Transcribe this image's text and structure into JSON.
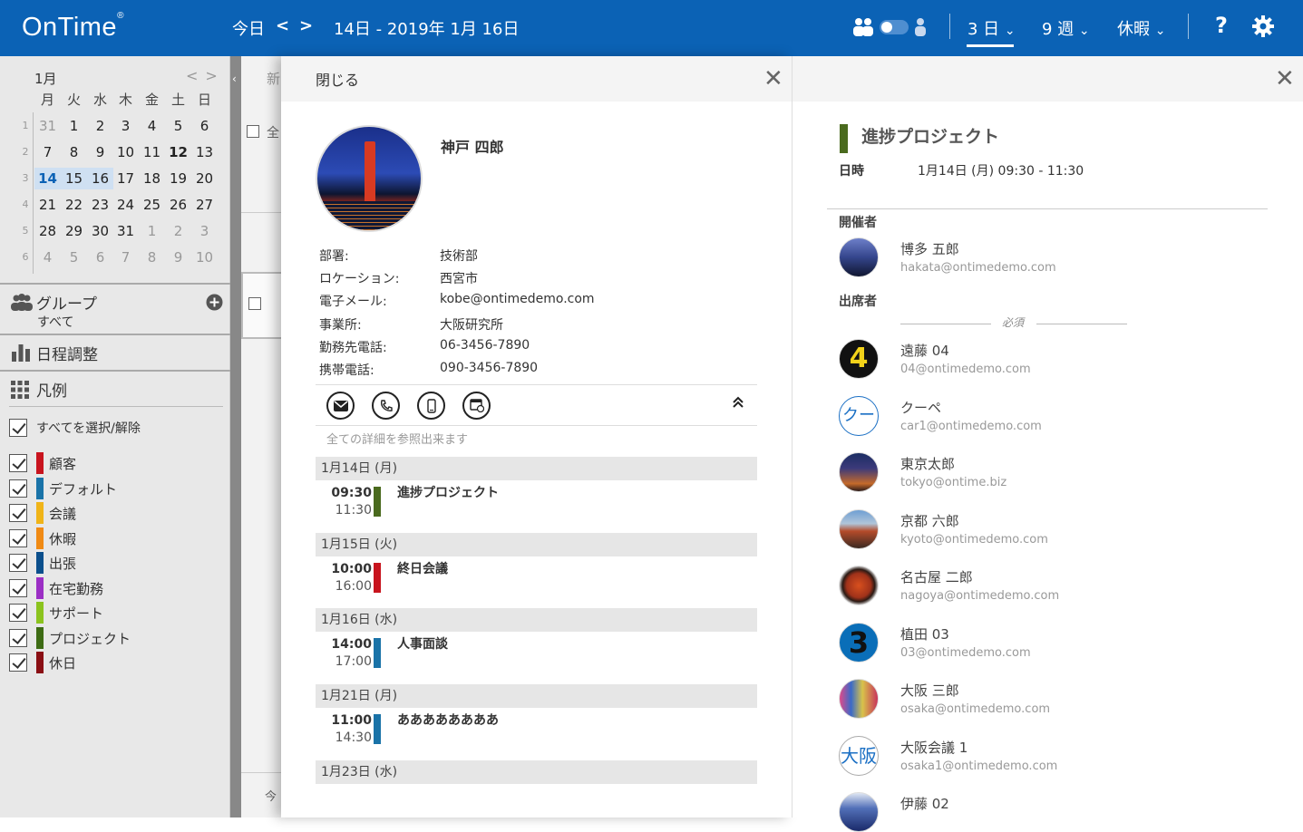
{
  "header": {
    "logo": "OnTime",
    "logo_mark": "®",
    "today": "今日",
    "prev": "<",
    "next": ">",
    "date_range": "14日  -  2019年 1月 16日",
    "view_days": "3 日",
    "view_weeks": "9 週",
    "view_holiday": "休暇",
    "help": "?",
    "chevron": "⌄"
  },
  "mini_calendar": {
    "month": "1月",
    "nav_prev": "<",
    "nav_next": ">",
    "weekdays": [
      "月",
      "火",
      "水",
      "木",
      "金",
      "土",
      "日"
    ],
    "weeks": [
      {
        "no": "1",
        "days": [
          "31",
          "1",
          "2",
          "3",
          "4",
          "5",
          "6"
        ]
      },
      {
        "no": "2",
        "days": [
          "7",
          "8",
          "9",
          "10",
          "11",
          "12",
          "13"
        ]
      },
      {
        "no": "3",
        "days": [
          "14",
          "15",
          "16",
          "17",
          "18",
          "19",
          "20"
        ]
      },
      {
        "no": "4",
        "days": [
          "21",
          "22",
          "23",
          "24",
          "25",
          "26",
          "27"
        ]
      },
      {
        "no": "5",
        "days": [
          "28",
          "29",
          "30",
          "31",
          "1",
          "2",
          "3"
        ]
      },
      {
        "no": "6",
        "days": [
          "4",
          "5",
          "6",
          "7",
          "8",
          "9",
          "10"
        ]
      }
    ]
  },
  "sidebar": {
    "group_label": "グループ",
    "group_value": "すべて",
    "schedule_label": "日程調整",
    "legend_label": "凡例",
    "select_all": "すべてを選択/解除",
    "legend": [
      {
        "label": "顧客",
        "color": "#c8141e"
      },
      {
        "label": "デフォルト",
        "color": "#1a73a8"
      },
      {
        "label": "会議",
        "color": "#f0b418"
      },
      {
        "label": "休暇",
        "color": "#f08a14"
      },
      {
        "label": "出張",
        "color": "#0b4f8c"
      },
      {
        "label": "在宅勤務",
        "color": "#9b2fc4"
      },
      {
        "label": "サポート",
        "color": "#8bc31e"
      },
      {
        "label": "プロジェクト",
        "color": "#3d6b14"
      },
      {
        "label": "休日",
        "color": "#8a0f14"
      }
    ]
  },
  "profile": {
    "close_label": "閉じる",
    "name": "神戸 四郎",
    "fields": [
      {
        "key": "部署:",
        "value": "技術部"
      },
      {
        "key": "ロケーション:",
        "value": "西宮市"
      },
      {
        "key": "電子メール:",
        "value": "kobe@ontimedemo.com"
      },
      {
        "key": "事業所:",
        "value": "大阪研究所"
      },
      {
        "key": "勤務先電話:",
        "value": "06-3456-7890"
      },
      {
        "key": "携帯電話:",
        "value": "090-3456-7890"
      }
    ],
    "details_link": "全ての詳細を参照出来ます",
    "events": [
      {
        "date": "1月14日 (月)",
        "start": "09:30",
        "end": "11:30",
        "title": "進捗プロジェクト",
        "color": "#4a6a1e"
      },
      {
        "date": "1月15日 (火)",
        "start": "10:00",
        "end": "16:00",
        "title": "終日会議",
        "color": "#c8141e"
      },
      {
        "date": "1月16日 (水)",
        "start": "14:00",
        "end": "17:00",
        "title": "人事面談",
        "color": "#1a73a8"
      },
      {
        "date": "1月21日 (月)",
        "start": "11:00",
        "end": "14:30",
        "title": "ああああああああ",
        "color": "#1a73a8"
      },
      {
        "date": "1月23日 (水)"
      }
    ]
  },
  "meeting": {
    "title": "進捗プロジェクト",
    "color": "#4a6a1e",
    "datetime_label": "日時",
    "datetime_value": "1月14日 (月) 09:30 - 11:30",
    "organizer_label": "開催者",
    "organizer": {
      "name": "博多 五郎",
      "email": "hakata@ontimedemo.com"
    },
    "attendees_label": "出席者",
    "required_label": "必須",
    "attendees": [
      {
        "name": "遠藤 04",
        "email": "04@ontimedemo.com",
        "avatar_text": "4"
      },
      {
        "name": "クーペ",
        "email": "car1@ontimedemo.com",
        "avatar_text": "クー"
      },
      {
        "name": "東京太郎",
        "email": "tokyo@ontime.biz",
        "avatar_text": ""
      },
      {
        "name": "京都 六郎",
        "email": "kyoto@ontimedemo.com",
        "avatar_text": ""
      },
      {
        "name": "名古屋 二郎",
        "email": "nagoya@ontimedemo.com",
        "avatar_text": ""
      },
      {
        "name": "植田 03",
        "email": "03@ontimedemo.com",
        "avatar_text": "3"
      },
      {
        "name": "大阪 三郎",
        "email": "osaka@ontimedemo.com",
        "avatar_text": ""
      },
      {
        "name": "大阪会議 1",
        "email": "osaka1@ontimedemo.com",
        "avatar_text": "大阪"
      },
      {
        "name": "伊藤 02",
        "email": "",
        "avatar_text": ""
      }
    ]
  },
  "background": {
    "col_frag_1": "新",
    "col_frag_2": "全",
    "col_frag_3": "今"
  }
}
